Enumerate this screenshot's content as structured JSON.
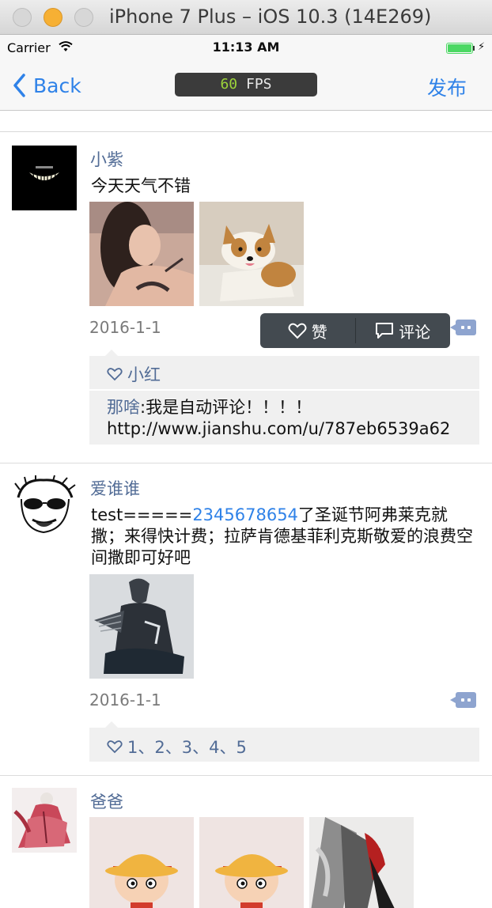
{
  "window": {
    "title": "iPhone 7 Plus – iOS 10.3 (14E269)"
  },
  "status_bar": {
    "carrier": "Carrier",
    "time": "11:13 AM"
  },
  "nav": {
    "back_label": "Back",
    "fps_value": "60",
    "fps_unit": "FPS",
    "publish_label": "发布"
  },
  "posts": [
    {
      "username": "小紫",
      "text": "今天天气不错",
      "date": "2016-1-1",
      "likes": "小红",
      "comment_author": "那啥",
      "comment_text": ":我是自动评论！！！！ http://www.jianshu.com/u/787eb6539a62"
    },
    {
      "username": "爱谁谁",
      "text_prefix": "test=====",
      "text_link": "2345678654",
      "text_suffix": "了圣诞节阿弗莱克就撒；来得快计费；拉萨肯德基菲利克斯敬爱的浪费空间撒即可好吧",
      "date": "2016-1-1",
      "likes": "1、2、3、4、5"
    },
    {
      "username": "爸爸"
    }
  ],
  "action_popup": {
    "like_label": "赞",
    "comment_label": "评论"
  },
  "colors": {
    "accent": "#2f82e8",
    "username": "#526c96",
    "fps_green": "#9dd43a"
  }
}
